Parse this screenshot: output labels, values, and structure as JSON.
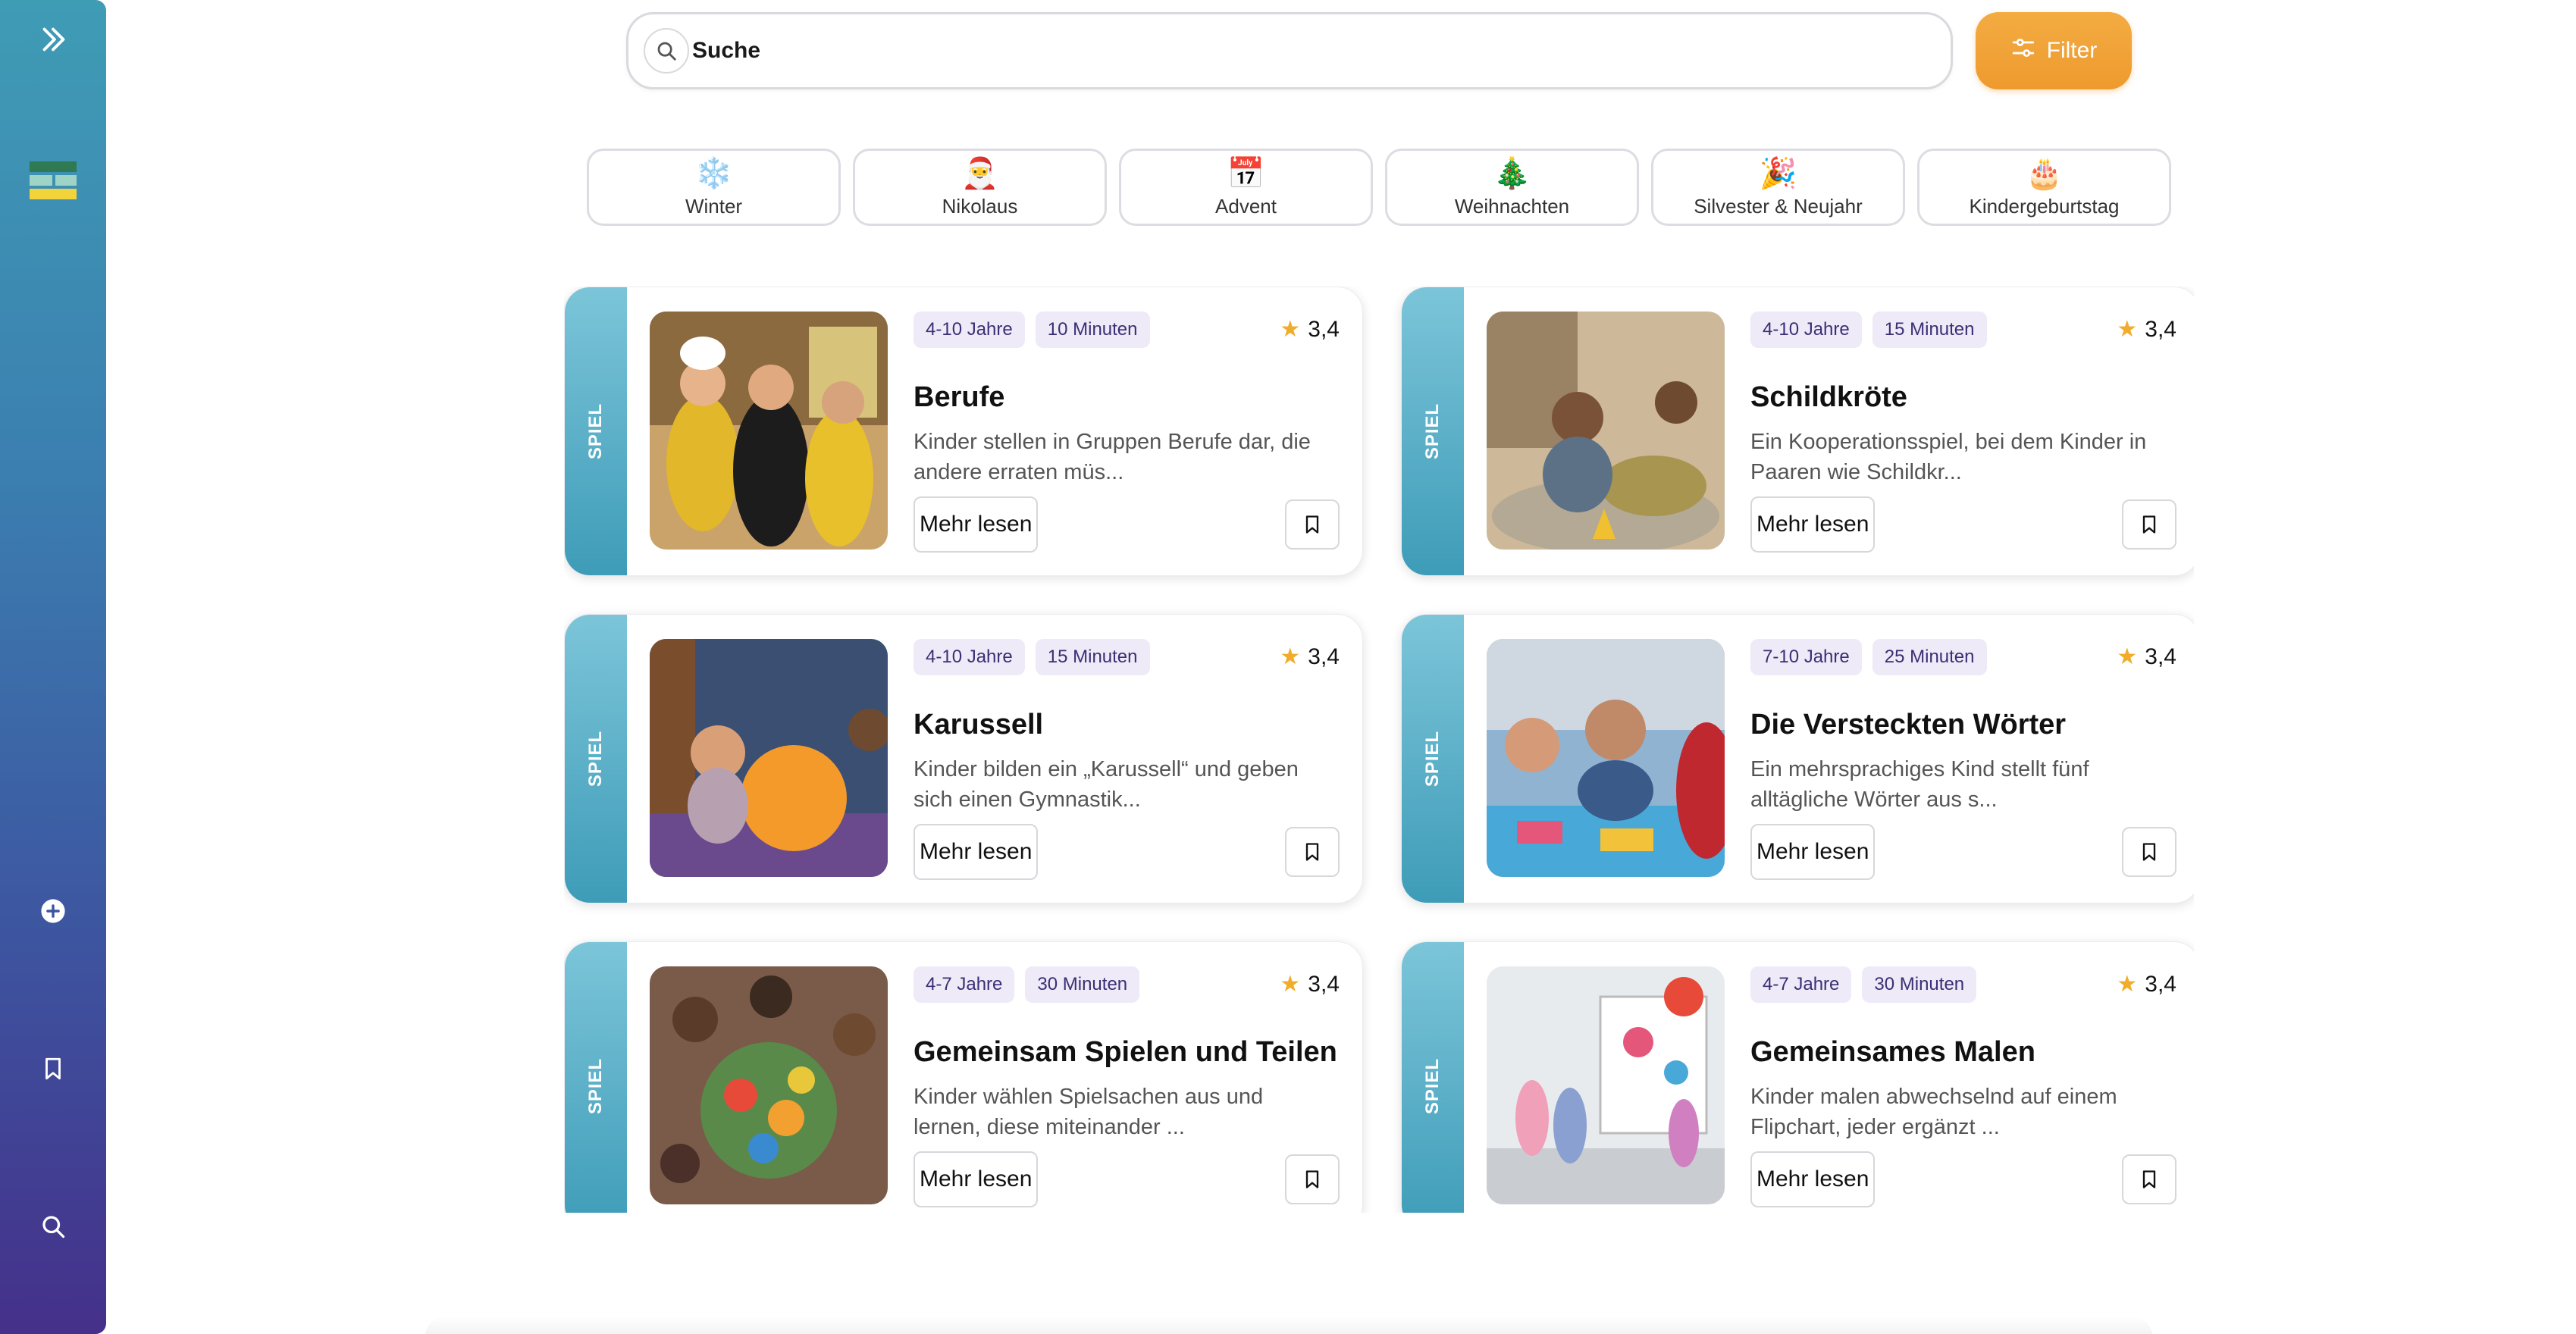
{
  "search": {
    "placeholder": "Suche",
    "value": ""
  },
  "filter": {
    "label": "Filter"
  },
  "colors": {
    "accent": "#ee9a2e",
    "sidebar_top": "#3f9cb5",
    "sidebar_bottom": "#45308a",
    "tag_bg": "#eeeaf7",
    "star": "#f0ac2a"
  },
  "sidebar": {
    "icons": [
      "chevrons-right-icon",
      "logo-icon",
      "add-icon",
      "bookmark-icon",
      "search-icon"
    ]
  },
  "categories": [
    {
      "emoji": "❄️",
      "label": "Winter",
      "icon": "snowflake-icon"
    },
    {
      "emoji": "🎅",
      "label": "Nikolaus",
      "icon": "santa-hat-icon"
    },
    {
      "emoji": "📅",
      "label": "Advent",
      "icon": "calendar-icon"
    },
    {
      "emoji": "🎄",
      "label": "Weihnachten",
      "icon": "wreath-icon"
    },
    {
      "emoji": "🎉",
      "label": "Silvester & Neujahr",
      "icon": "party-popper-icon"
    },
    {
      "emoji": "🎂",
      "label": "Kindergeburtstag",
      "icon": "cake-icon"
    }
  ],
  "cards": [
    {
      "type": "SPIEL",
      "age": "4-10 Jahre",
      "duration": "10 Minuten",
      "rating": "3,4",
      "title": "Berufe",
      "desc": "Kinder stellen in Gruppen Berufe dar, die andere erraten müs...",
      "more": "Mehr lesen"
    },
    {
      "type": "SPIEL",
      "age": "4-10 Jahre",
      "duration": "15 Minuten",
      "rating": "3,4",
      "title": "Schildkröte",
      "desc": "Ein Kooperationsspiel, bei dem Kinder in Paaren wie Schildkr...",
      "more": "Mehr lesen"
    },
    {
      "type": "SPIEL",
      "age": "4-10 Jahre",
      "duration": "15 Minuten",
      "rating": "3,4",
      "title": "Karussell",
      "desc": "Kinder bilden ein „Karussell“ und geben sich einen Gymnastik...",
      "more": "Mehr lesen"
    },
    {
      "type": "SPIEL",
      "age": "7-10 Jahre",
      "duration": "25 Minuten",
      "rating": "3,4",
      "title": "Die Versteckten Wörter",
      "desc": "Ein mehrsprachiges Kind stellt fünf alltägliche Wörter aus s...",
      "more": "Mehr lesen"
    },
    {
      "type": "SPIEL",
      "age": "4-7 Jahre",
      "duration": "30 Minuten",
      "rating": "3,4",
      "title": "Gemeinsam Spielen und Teilen",
      "desc": "Kinder wählen Spielsachen aus und lernen, diese miteinander ...",
      "more": "Mehr lesen"
    },
    {
      "type": "SPIEL",
      "age": "4-7 Jahre",
      "duration": "30 Minuten",
      "rating": "3,4",
      "title": "Gemeinsames Malen",
      "desc": "Kinder malen abwechselnd auf einem Flipchart, jeder ergänzt ...",
      "more": "Mehr lesen"
    }
  ]
}
